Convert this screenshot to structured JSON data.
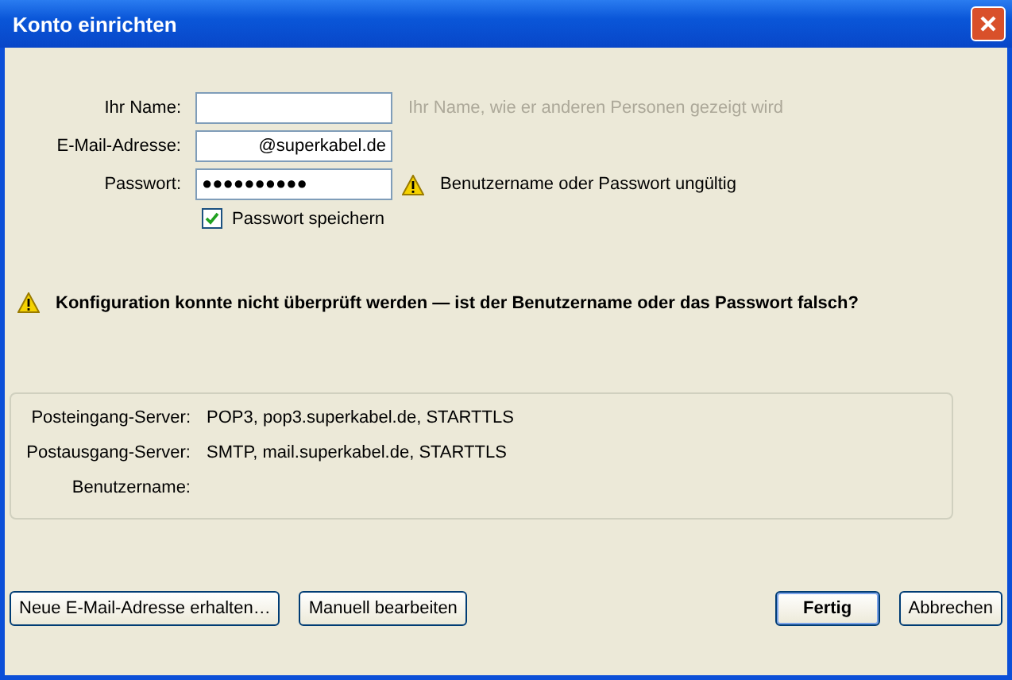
{
  "window": {
    "title": "Konto einrichten"
  },
  "form": [
    {
      "label": "Ihr Name:",
      "hint": "Ihr Name, wie er anderen Personen gezeigt wird"
    },
    {
      "label": "E-Mail-Adresse:",
      "value": "@superkabel.de"
    },
    {
      "label": "Passwort:",
      "value": "●●●●●●●●●●",
      "warning": "Benutzername oder Passwort ungültig"
    }
  ],
  "save_password": {
    "label": "Passwort speichern",
    "checked": true
  },
  "error_message": "Konfiguration konnte nicht überprüft werden — ist der Benutzername oder das Passwort falsch?",
  "server_details": [
    {
      "label": "Posteingang-Server:",
      "value": "POP3, pop3.superkabel.de, STARTTLS"
    },
    {
      "label": "Postausgang-Server:",
      "value": "SMTP, mail.superkabel.de, STARTTLS"
    },
    {
      "label": "Benutzername:"
    }
  ],
  "left_buttons": [
    {
      "label": "Neue E-Mail-Adresse erhalten…",
      "default": false
    },
    {
      "label": "Manuell bearbeiten",
      "default": false
    }
  ],
  "right_buttons": [
    {
      "label": "Fertig",
      "default": true
    },
    {
      "label": "Abbrechen",
      "default": false
    }
  ]
}
